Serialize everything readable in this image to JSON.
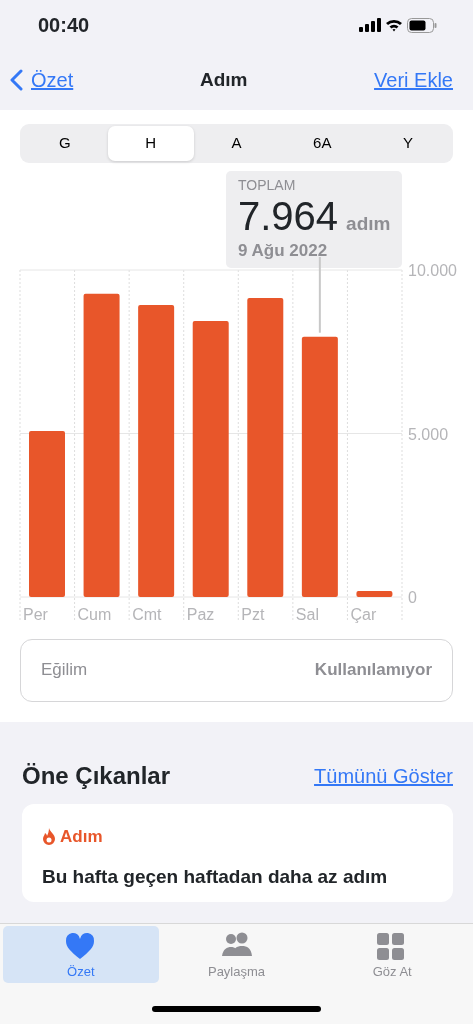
{
  "status_bar": {
    "time": "00:40"
  },
  "nav": {
    "back": "Özet",
    "title": "Adım",
    "action": "Veri Ekle"
  },
  "segments": [
    {
      "label": "G",
      "selected": false
    },
    {
      "label": "H",
      "selected": true
    },
    {
      "label": "A",
      "selected": false
    },
    {
      "label": "6A",
      "selected": false
    },
    {
      "label": "Y",
      "selected": false
    }
  ],
  "tooltip": {
    "label": "TOPLAM",
    "value": "7.964",
    "unit": "adım",
    "date": "9 Ağu 2022"
  },
  "chart": {
    "chart_data": {
      "type": "bar",
      "categories": [
        "Per",
        "Cum",
        "Cmt",
        "Paz",
        "Pzt",
        "Sal",
        "Çar"
      ],
      "series": [
        {
          "color": "#e8562a",
          "values": [
            5080,
            9270,
            8930,
            8440,
            9140,
            7960,
            180
          ]
        }
      ],
      "ylim": [
        0,
        10000
      ],
      "yticks": [
        {
          "value": 0,
          "label": "0"
        },
        {
          "value": 5000,
          "label": "5.000"
        },
        {
          "value": 10000,
          "label": "10.000"
        }
      ]
    }
  },
  "trend": {
    "label": "Eğilim",
    "value": "Kullanılamıyor"
  },
  "highlights": {
    "title": "Öne Çıkanlar",
    "link": "Tümünü Göster",
    "card": {
      "category": "Adım",
      "text": "Bu hafta geçen haftadan daha az adım"
    }
  },
  "tab_bar": [
    {
      "label": "Özet",
      "selected": true
    },
    {
      "label": "Paylaşma",
      "selected": false
    },
    {
      "label": "Göz At",
      "selected": false
    }
  ]
}
